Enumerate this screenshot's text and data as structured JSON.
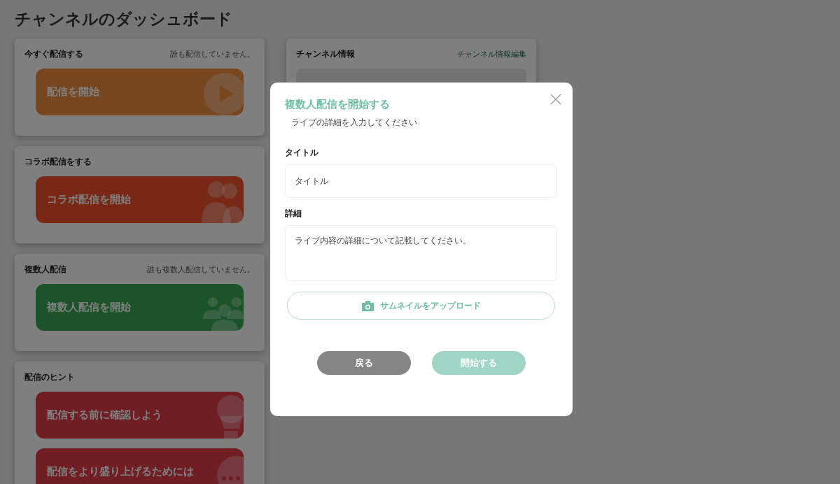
{
  "page": {
    "title": "チャンネルのダッシュボード"
  },
  "cards": [
    {
      "heading": "今すぐ配信する",
      "status": "誰も配信していません。",
      "actions": [
        {
          "label": "配信を開始"
        }
      ]
    },
    {
      "heading": "コラボ配信をする",
      "actions": [
        {
          "label": "コラボ配信を開始"
        }
      ]
    },
    {
      "heading": "複数人配信",
      "status": "誰も複数人配信していません。",
      "actions": [
        {
          "label": "複数人配信を開始"
        }
      ]
    },
    {
      "heading": "配信のヒント",
      "actions": [
        {
          "label": "配信する前に確認しよう"
        },
        {
          "label": "配信をより盛り上げるためには"
        }
      ]
    }
  ],
  "channel_info": {
    "heading": "チャンネル情報",
    "link": "チャンネル情報編集"
  },
  "modal": {
    "title": "複数人配信を開始する",
    "subtitle": "ライブの詳細を入力してください",
    "fields": [
      {
        "label": "タイトル",
        "placeholder": "タイトル",
        "kind": "input"
      },
      {
        "label": "詳細",
        "placeholder": "ライブ内容の詳細について記載してください。",
        "kind": "textarea"
      }
    ],
    "upload": "サムネイルをアップロード",
    "buttons": [
      {
        "label": "戻る",
        "kind": "secondary",
        "disabled": false
      },
      {
        "label": "開始する",
        "kind": "primary",
        "disabled": true
      }
    ]
  }
}
